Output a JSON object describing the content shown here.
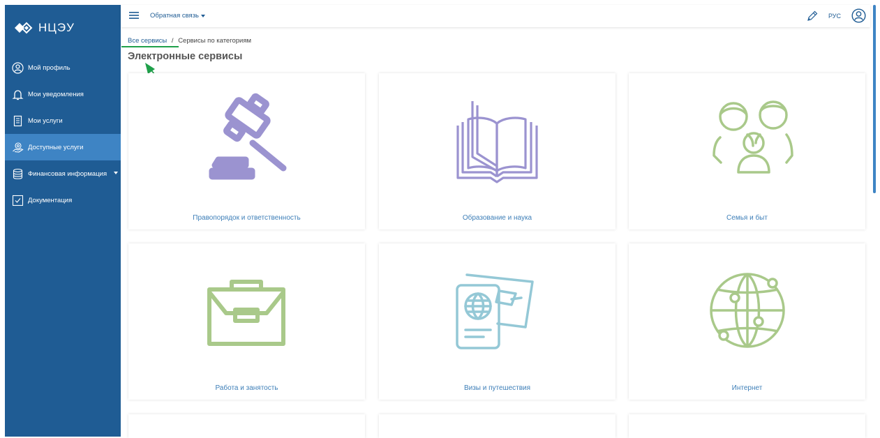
{
  "logo": {
    "text": "НЦЭУ"
  },
  "sidebar": {
    "items": [
      {
        "label": "Мой профиль",
        "icon": "profile-icon",
        "active": false
      },
      {
        "label": "Мои уведомления",
        "icon": "bell-icon",
        "active": false
      },
      {
        "label": "Мои услуги",
        "icon": "document-list-icon",
        "active": false
      },
      {
        "label": "Доступные услуги",
        "icon": "hand-services-icon",
        "active": true
      },
      {
        "label": "Финансовая информация",
        "icon": "database-icon",
        "active": false,
        "has_submenu": true
      },
      {
        "label": "Документация",
        "icon": "checkbox-icon",
        "active": false
      }
    ]
  },
  "topbar": {
    "feedback_label": "Обратная связь",
    "lang_label": "РУС"
  },
  "breadcrumb": {
    "root": "Все сервисы",
    "separator": "/",
    "current": "Сервисы по категориям"
  },
  "page_title": "Электронные сервисы",
  "categories": [
    {
      "label": "Правопорядок и ответственность",
      "icon": "gavel-icon",
      "color": "#9b93d0"
    },
    {
      "label": "Образование и наука",
      "icon": "book-icon",
      "color": "#9b93d0"
    },
    {
      "label": "Семья и быт",
      "icon": "family-icon",
      "color": "#a9c98a"
    },
    {
      "label": "Работа и занятость",
      "icon": "briefcase-icon",
      "color": "#a9c98a"
    },
    {
      "label": "Визы и путешествия",
      "icon": "passport-icon",
      "color": "#94c8d6"
    },
    {
      "label": "Интернет",
      "icon": "globe-icon",
      "color": "#a9c98a"
    }
  ],
  "colors": {
    "sidebar": "#1f5c94",
    "sidebar_active": "#3e84c4",
    "link": "#1f5c94",
    "annotation": "#1fa04a"
  }
}
